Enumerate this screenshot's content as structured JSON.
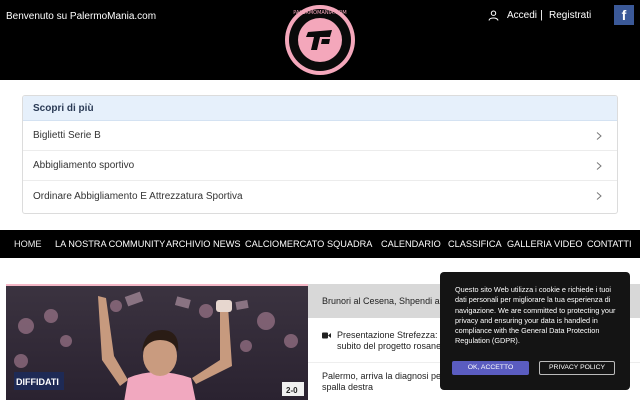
{
  "header": {
    "welcome": "Benvenuto su PalermoMania.com",
    "login_label": "Accedi",
    "separator": "|",
    "register_label": "Registrati",
    "facebook_label": "f",
    "logo_text": "PALERMOMANIA.COM",
    "colors": {
      "background": "#000000",
      "brand_pink": "#f4a7bb"
    }
  },
  "discover": {
    "title": "Scopri di più",
    "items": [
      {
        "label": "Biglietti Serie B"
      },
      {
        "label": "Abbigliamento sportivo"
      },
      {
        "label": "Ordinare Abbigliamento E Attrezzatura Sportiva"
      }
    ]
  },
  "nav": {
    "items": [
      {
        "label": "HOME"
      },
      {
        "label": "LA NOSTRA COMMUNITY"
      },
      {
        "label": "ARCHIVIO NEWS"
      },
      {
        "label": "CALCIOMERCATO"
      },
      {
        "label": "SQUADRA"
      },
      {
        "label": "CALENDARIO"
      },
      {
        "label": "CLASSIFICA"
      },
      {
        "label": "GALLERIA VIDEO"
      },
      {
        "label": "CONTATTI"
      }
    ]
  },
  "news": {
    "items": [
      {
        "title": "Brunori al Cesena, Shpendi a Pa"
      },
      {
        "title": "Presentazione Strefezza: \"M",
        "title_line2": "subito del progetto rosane",
        "icon": "video-icon"
      },
      {
        "title": "Palermo, arriva la diagnosi per",
        "title_line2": "spalla destra"
      }
    ]
  },
  "cookie": {
    "text": "Questo sito Web utilizza i cookie e richiede i tuoi dati personali per migliorare la tua esperienza di navigazione. We are committed to protecting your privacy and ensuring your data is handled in compliance with the General Data Protection Regulation (GDPR).",
    "accept_label": "OK, ACCETTO",
    "policy_label": "PRIVACY POLICY",
    "colors": {
      "accept": "#5a5cc0"
    }
  },
  "hero_photo": {
    "banner_text": "DIFFIDATI",
    "score_text": "2-0"
  }
}
